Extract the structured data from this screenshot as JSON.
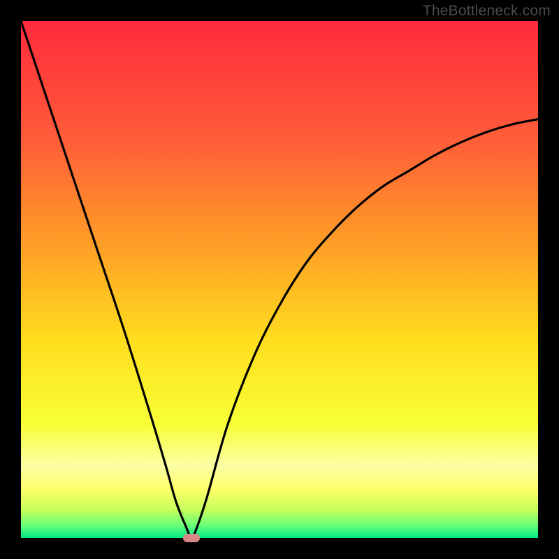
{
  "watermark": "TheBottleneck.com",
  "chart_data": {
    "type": "line",
    "title": "",
    "xlabel": "",
    "ylabel": "",
    "xlim": [
      0,
      100
    ],
    "ylim": [
      0,
      100
    ],
    "grid": false,
    "series": [
      {
        "name": "bottleneck-curve",
        "x": [
          0,
          5,
          10,
          15,
          20,
          25,
          28,
          30,
          32,
          33,
          34,
          36,
          40,
          45,
          50,
          55,
          60,
          65,
          70,
          75,
          80,
          85,
          90,
          95,
          100
        ],
        "values": [
          100,
          85,
          70,
          55,
          40,
          24,
          14,
          7,
          2,
          0,
          2,
          8,
          22,
          35,
          45,
          53,
          59,
          64,
          68,
          71,
          74,
          76.5,
          78.5,
          80,
          81
        ]
      }
    ],
    "marker": {
      "x": 33,
      "y": 0,
      "color": "#d98888"
    },
    "gradient_stops": [
      {
        "offset": 0,
        "color": "#ff2b3c"
      },
      {
        "offset": 0.22,
        "color": "#ff5a39"
      },
      {
        "offset": 0.45,
        "color": "#ffa425"
      },
      {
        "offset": 0.62,
        "color": "#ffde1e"
      },
      {
        "offset": 0.78,
        "color": "#f7ff37"
      },
      {
        "offset": 0.86,
        "color": "#fbffa4"
      },
      {
        "offset": 0.905,
        "color": "#ffff6a"
      },
      {
        "offset": 0.945,
        "color": "#c7ff5a"
      },
      {
        "offset": 0.975,
        "color": "#6cff78"
      },
      {
        "offset": 1,
        "color": "#00e884"
      }
    ]
  }
}
